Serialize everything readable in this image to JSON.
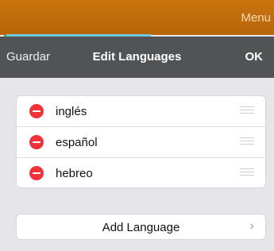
{
  "app_bar": {
    "menu_label": "Menu"
  },
  "header": {
    "left": "Guardar",
    "title": "Edit Languages",
    "right": "OK"
  },
  "languages": [
    {
      "label": "inglés"
    },
    {
      "label": "español"
    },
    {
      "label": "hebreo"
    }
  ],
  "add_language": {
    "label": "Add Language",
    "chevron": "›"
  },
  "colors": {
    "app_bar": "#c16d0c",
    "header": "#525355",
    "delete": "#f0323a",
    "accent_line": "#6fc7da"
  }
}
